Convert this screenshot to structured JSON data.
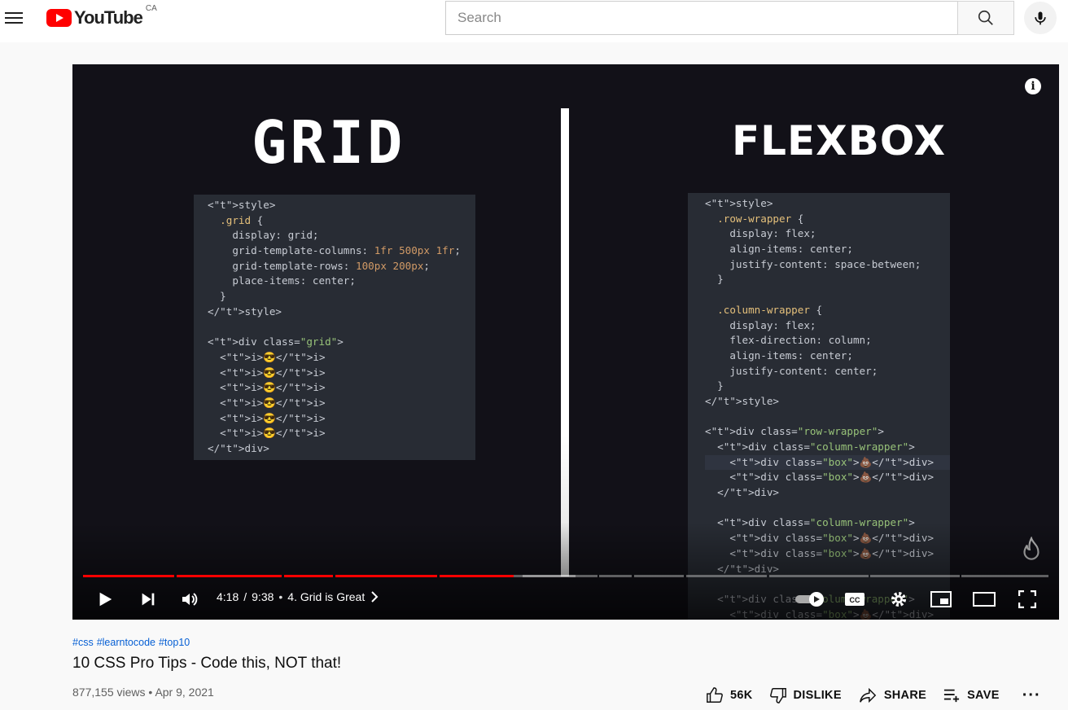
{
  "header": {
    "logo_text": "YouTube",
    "region": "CA",
    "search_placeholder": "Search"
  },
  "video": {
    "slide_left_heading": "GRID",
    "slide_right_heading": "FLEXBOX",
    "code_left": [
      "<style>",
      "  .grid {",
      "    display: grid;",
      "    grid-template-columns: 1fr 500px 1fr;",
      "    grid-template-rows: 100px 200px;",
      "    place-items: center;",
      "  }",
      "</style>",
      "",
      "<div class=\"grid\">",
      "  <i>😎</i>",
      "  <i>😎</i>",
      "  <i>😎</i>",
      "  <i>😎</i>",
      "  <i>😎</i>",
      "  <i>😎</i>",
      "</div>"
    ],
    "code_right": [
      "<style>",
      "  .row-wrapper {",
      "    display: flex;",
      "    align-items: center;",
      "    justify-content: space-between;",
      "  }",
      "",
      "  .column-wrapper {",
      "    display: flex;",
      "    flex-direction: column;",
      "    align-items: center;",
      "    justify-content: center;",
      "  }",
      "</style>",
      "",
      "<div class=\"row-wrapper\">",
      "  <div class=\"column-wrapper\">",
      "    <div class=\"box\">💩</div>",
      "    <div class=\"box\">💩</div>",
      "  </div>",
      "",
      "  <div class=\"column-wrapper\">",
      "    <div class=\"box\">💩</div>",
      "    <div class=\"box\">💩</div>",
      "  </div>",
      "",
      "  <div class=\"column-wrapper\">",
      "    <div class=\"box\">💩</div>"
    ],
    "current_time": "4:18",
    "duration": "9:38",
    "chapter": "4. Grid is Great",
    "progress_fraction": 0.4458,
    "accent_color": "#ff0000"
  },
  "info": {
    "hashtags": [
      "#css",
      "#learntocode",
      "#top10"
    ],
    "title": "10 CSS Pro Tips - Code this, NOT that!",
    "views": "877,155 views",
    "date": "Apr 9, 2021",
    "meta_separator": "•",
    "likes": "56K",
    "dislike_label": "DISLIKE",
    "share_label": "SHARE",
    "save_label": "SAVE"
  }
}
